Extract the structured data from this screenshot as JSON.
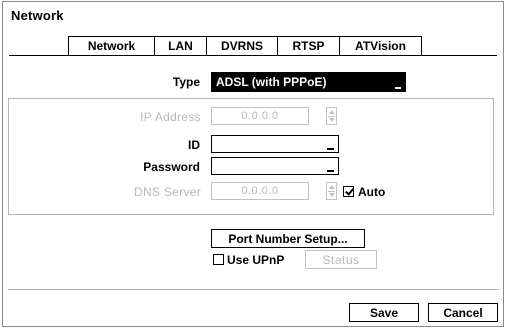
{
  "window": {
    "title": "Network"
  },
  "tabs": [
    {
      "label": "Network",
      "active": false
    },
    {
      "label": "LAN",
      "active": true
    },
    {
      "label": "DVRNS",
      "active": false
    },
    {
      "label": "RTSP",
      "active": false
    },
    {
      "label": "ATVision",
      "active": false
    }
  ],
  "type": {
    "label": "Type",
    "value": "ADSL (with PPPoE)"
  },
  "ip_address": {
    "label": "IP Address",
    "value": "0.0.0.0",
    "enabled": false
  },
  "id_field": {
    "label": "ID",
    "value": ""
  },
  "password_field": {
    "label": "Password",
    "value": ""
  },
  "dns_server": {
    "label": "DNS Server",
    "value": "0.0.0.0",
    "enabled": false,
    "auto_label": "Auto",
    "auto_checked": true
  },
  "port_number_setup": {
    "label": "Port Number Setup..."
  },
  "use_upnp": {
    "label": "Use UPnP",
    "checked": false
  },
  "status_button": {
    "label": "Status",
    "enabled": false
  },
  "footer": {
    "save_label": "Save",
    "cancel_label": "Cancel"
  }
}
